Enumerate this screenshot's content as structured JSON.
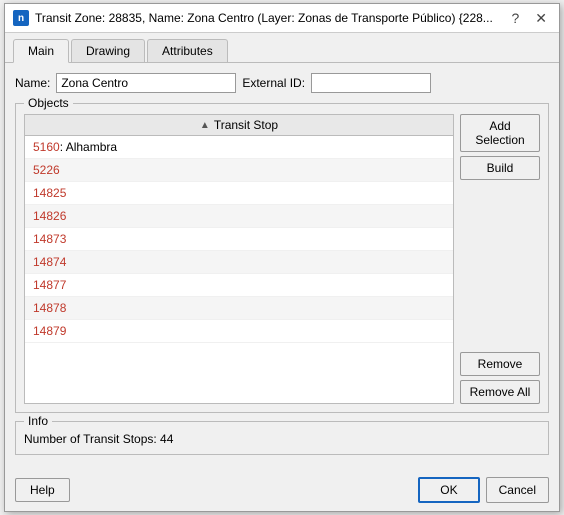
{
  "window": {
    "title": "Transit Zone: 28835, Name: Zona Centro (Layer: Zonas de Transporte Público) {228...",
    "icon_label": "n"
  },
  "title_buttons": {
    "help": "?",
    "close": "✕"
  },
  "tabs": [
    {
      "label": "Main",
      "active": true
    },
    {
      "label": "Drawing",
      "active": false
    },
    {
      "label": "Attributes",
      "active": false
    }
  ],
  "name_field": {
    "label": "Name:",
    "value": "Zona Centro",
    "placeholder": ""
  },
  "external_id_field": {
    "label": "External ID:",
    "value": "",
    "placeholder": ""
  },
  "objects_group": {
    "label": "Objects",
    "column_header": "Transit Stop",
    "rows": [
      {
        "id": "5160",
        "name": "Alhambra"
      },
      {
        "id": "5226",
        "name": ""
      },
      {
        "id": "14825",
        "name": ""
      },
      {
        "id": "14826",
        "name": ""
      },
      {
        "id": "14873",
        "name": ""
      },
      {
        "id": "14874",
        "name": ""
      },
      {
        "id": "14877",
        "name": ""
      },
      {
        "id": "14878",
        "name": ""
      },
      {
        "id": "14879",
        "name": ""
      }
    ],
    "buttons": {
      "add_selection": "Add Selection",
      "build": "Build",
      "remove": "Remove",
      "remove_all": "Remove All"
    }
  },
  "info_group": {
    "label": "Info",
    "text": "Number of Transit Stops: 44"
  },
  "footer": {
    "help_label": "Help",
    "ok_label": "OK",
    "cancel_label": "Cancel"
  }
}
